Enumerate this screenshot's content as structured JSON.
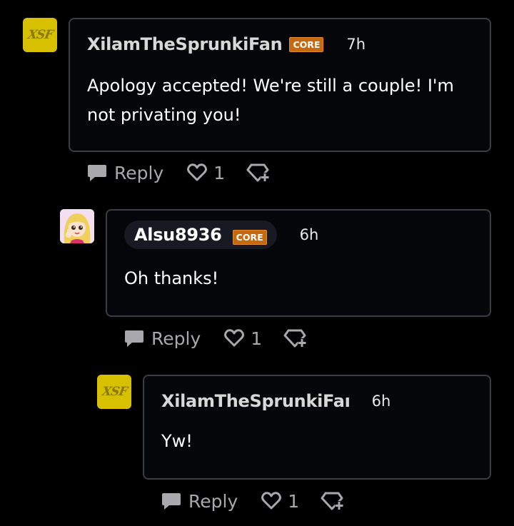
{
  "comments": [
    {
      "username": "XilamTheSprunkiFan",
      "badge": "CORE",
      "time": "7h",
      "text": "Apology accepted! We're still a couple! I'm not privating you!",
      "actions": {
        "reply_label": "Reply",
        "like_count": "1"
      }
    },
    {
      "username": "Alsu8936",
      "badge": "CORE",
      "time": "6h",
      "text": "Oh thanks!",
      "actions": {
        "reply_label": "Reply",
        "like_count": "1"
      }
    },
    {
      "username": "XilamTheSprunkiFaı",
      "time": "6h",
      "text": "Yw!",
      "actions": {
        "reply_label": "Reply",
        "like_count": "1"
      }
    }
  ],
  "avatar_logo_text": "XSF",
  "colors": {
    "background": "#000000",
    "card_border": "#3a3d44",
    "badge": "#c56a10",
    "action_gray": "#a9a9ad",
    "avatar_yellow": "#d6c000"
  }
}
